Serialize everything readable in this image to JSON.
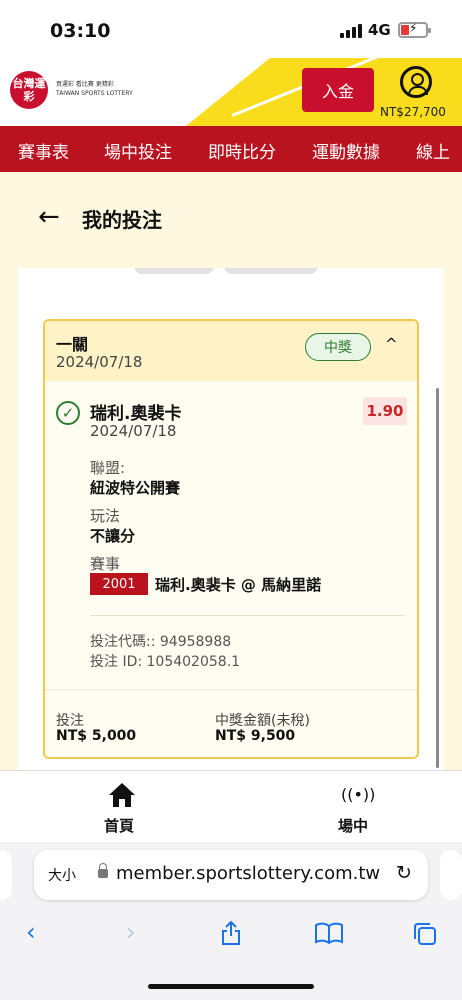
{
  "status_bar": {
    "time": "03:10",
    "network": "4G"
  },
  "header": {
    "logo_mark": "台灣運彩",
    "logo_tagline": "買運彩 看比賽 更精彩",
    "logo_sub": "TAIWAN SPORTS LOTTERY",
    "deposit_label": "入金",
    "balance": "NT$27,700"
  },
  "nav": {
    "items": [
      "賽事表",
      "場中投注",
      "即時比分",
      "運動數據",
      "線上"
    ]
  },
  "page": {
    "title": "我的投注"
  },
  "bet": {
    "type": "一關",
    "date": "2024/07/18",
    "status": "中獎",
    "selection": {
      "name": "瑞利.奧裴卡",
      "date": "2024/07/18",
      "odds": "1.90",
      "league_label": "聯盟:",
      "league": "紐波特公開賽",
      "market_label": "玩法",
      "market": "不讓分",
      "event_label": "賽事",
      "event_code": "2001",
      "event_name": "瑞利.奧裴卡 @ 馬納里諾"
    },
    "bet_code": "投注代碼:: 94958988",
    "bet_id": "投注 ID: 105402058.1",
    "stake_label": "投注",
    "stake": "NT$ 5,000",
    "payout_label": "中獎金額(未稅)",
    "payout": "NT$ 9,500"
  },
  "tabbar": {
    "home_label": "首頁",
    "live_label": "場中"
  },
  "browser": {
    "text_size": "大小",
    "url": "member.sportslottery.com.tw"
  },
  "colors": {
    "brand_red": "#b8131f",
    "accent_yellow": "#f9dc1c",
    "win_green": "#2e7d32",
    "link_blue": "#1a73e8"
  }
}
